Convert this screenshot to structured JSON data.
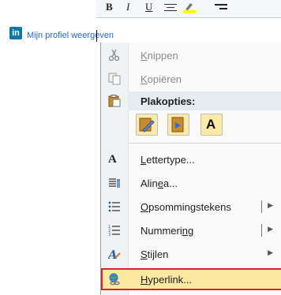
{
  "document": {
    "link_text": "Mijn profiel weergeven",
    "linkedin_badge": "in"
  },
  "mini_toolbar": {
    "bold": "B",
    "italic": "I",
    "underline": "U",
    "highlight_color": "#ffff00"
  },
  "context_menu": {
    "items": [
      {
        "label_pre": "",
        "label_key": "K",
        "label_post": "nippen",
        "icon": "scissors-icon",
        "enabled": false
      },
      {
        "label_pre": "",
        "label_key": "K",
        "label_post": "opiëren",
        "icon": "copy-icon",
        "enabled": false
      }
    ],
    "paste_header": "Plakopties:",
    "paste_options": [
      {
        "icon": "paste-keep-formatting-icon"
      },
      {
        "icon": "paste-merge-formatting-icon"
      },
      {
        "icon": "paste-text-only-icon",
        "glyph": "A"
      }
    ],
    "items2": [
      {
        "label_pre": "",
        "label_key": "L",
        "label_post": "ettertype...",
        "icon": "font-icon"
      },
      {
        "label_pre": "Alin",
        "label_key": "e",
        "label_post": "a...",
        "icon": "paragraph-icon"
      },
      {
        "label_pre": "",
        "label_key": "O",
        "label_post": "psommingstekens",
        "icon": "bullets-icon",
        "submenu": true
      },
      {
        "label_pre": "Nummeri",
        "label_key": "n",
        "label_post": "g",
        "icon": "numbering-icon",
        "submenu": true
      },
      {
        "label_pre": "",
        "label_key": "S",
        "label_post": "tijlen",
        "icon": "styles-icon",
        "submenu": true
      },
      {
        "label_pre": "",
        "label_key": "H",
        "label_post": "yperlink...",
        "icon": "hyperlink-icon",
        "highlighted": true
      }
    ],
    "font_glyph": "A",
    "submenu_arrow": "▶"
  },
  "colors": {
    "linkedin_blue": "#0e76a8",
    "link_blue": "#2a6ad0",
    "highlight_outline": "#e21f26",
    "hover_fill": "#fde8a2"
  }
}
